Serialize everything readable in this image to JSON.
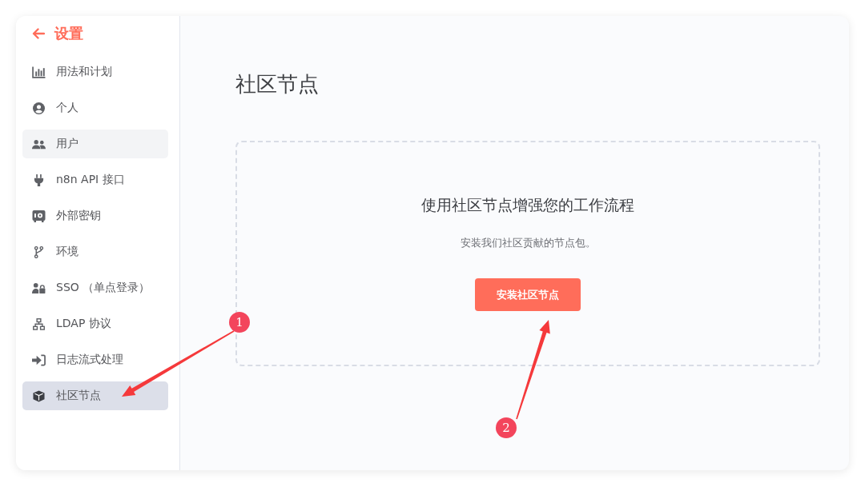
{
  "sidebar": {
    "back_label": "设置",
    "items": [
      {
        "label": "用法和计划",
        "selected": false,
        "hovered": false
      },
      {
        "label": "个人",
        "selected": false,
        "hovered": false
      },
      {
        "label": "用户",
        "selected": false,
        "hovered": true
      },
      {
        "label": "n8n API 接口",
        "selected": false,
        "hovered": false
      },
      {
        "label": "外部密钥",
        "selected": false,
        "hovered": false
      },
      {
        "label": "环境",
        "selected": false,
        "hovered": false
      },
      {
        "label": "SSO （单点登录）",
        "selected": false,
        "hovered": false
      },
      {
        "label": "LDAP 协议",
        "selected": false,
        "hovered": false
      },
      {
        "label": "日志流式处理",
        "selected": false,
        "hovered": false
      },
      {
        "label": "社区节点",
        "selected": true,
        "hovered": false
      }
    ]
  },
  "main": {
    "title": "社区节点",
    "empty_state": {
      "heading": "使用社区节点增强您的工作流程",
      "description": "安装我们社区贡献的节点包。",
      "button": "安装社区节点"
    }
  },
  "annotations": [
    {
      "label": "1"
    },
    {
      "label": "2"
    }
  ]
}
